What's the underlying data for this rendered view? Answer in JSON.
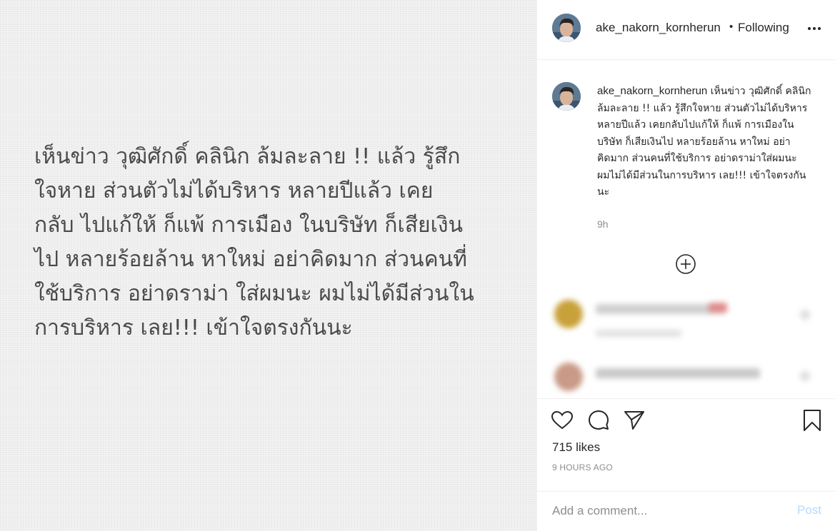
{
  "media": {
    "text": "เห็นข่าว วุฒิศักดิ์ คลินิก ล้มละลาย !! แล้ว รู้สึก\nใจหาย ส่วนตัวไม่ได้บริหาร หลายปีแล้ว เคย\nกลับ ไปแก้ให้ ก็แพ้ การเมือง ในบริษัท ก็เสียเงิน\nไป หลายร้อยล้าน หาใหม่ อย่าคิดมาก ส่วนคนที่\nใช้บริการ อย่าดราม่า ใส่ผมนะ ผมไม่ได้มีส่วนใน\nการบริหาร เลย!!!  เข้าใจตรงกันนะ"
  },
  "header": {
    "username": "ake_nakorn_kornherun",
    "dot": "•",
    "follow_status": "Following",
    "more_icon": "more-horizontal-icon"
  },
  "caption": {
    "username": "ake_nakorn_kornherun",
    "text": "เห็นข่าว วุฒิศักดิ์ คลินิก ล้มละลาย !! แล้ว รู้สึกใจหาย ส่วนตัวไม่ได้บริหาร หลายปีแล้ว เคยกลับไปแก้ให้ ก็แพ้ การเมืองในบริษัท ก็เสียเงินไป หลายร้อยล้าน หาใหม่ อย่าคิดมาก ส่วนคนที่ใช้บริการ อย่าดราม่าใส่ผมนะ ผมไม่ได้มีส่วนในการบริหาร เลย!!! เข้าใจตรงกันนะ",
    "time": "9h"
  },
  "actions": {
    "icons": [
      "heart-icon",
      "comment-icon",
      "share-icon",
      "bookmark-icon"
    ],
    "likes": "715 likes",
    "posted": "9 HOURS AGO"
  },
  "comment": {
    "placeholder": "Add a comment...",
    "post_label": "Post"
  },
  "colors": {
    "post_disabled": "#b3dbff",
    "muted": "#8e8e8e",
    "text": "#262626"
  }
}
